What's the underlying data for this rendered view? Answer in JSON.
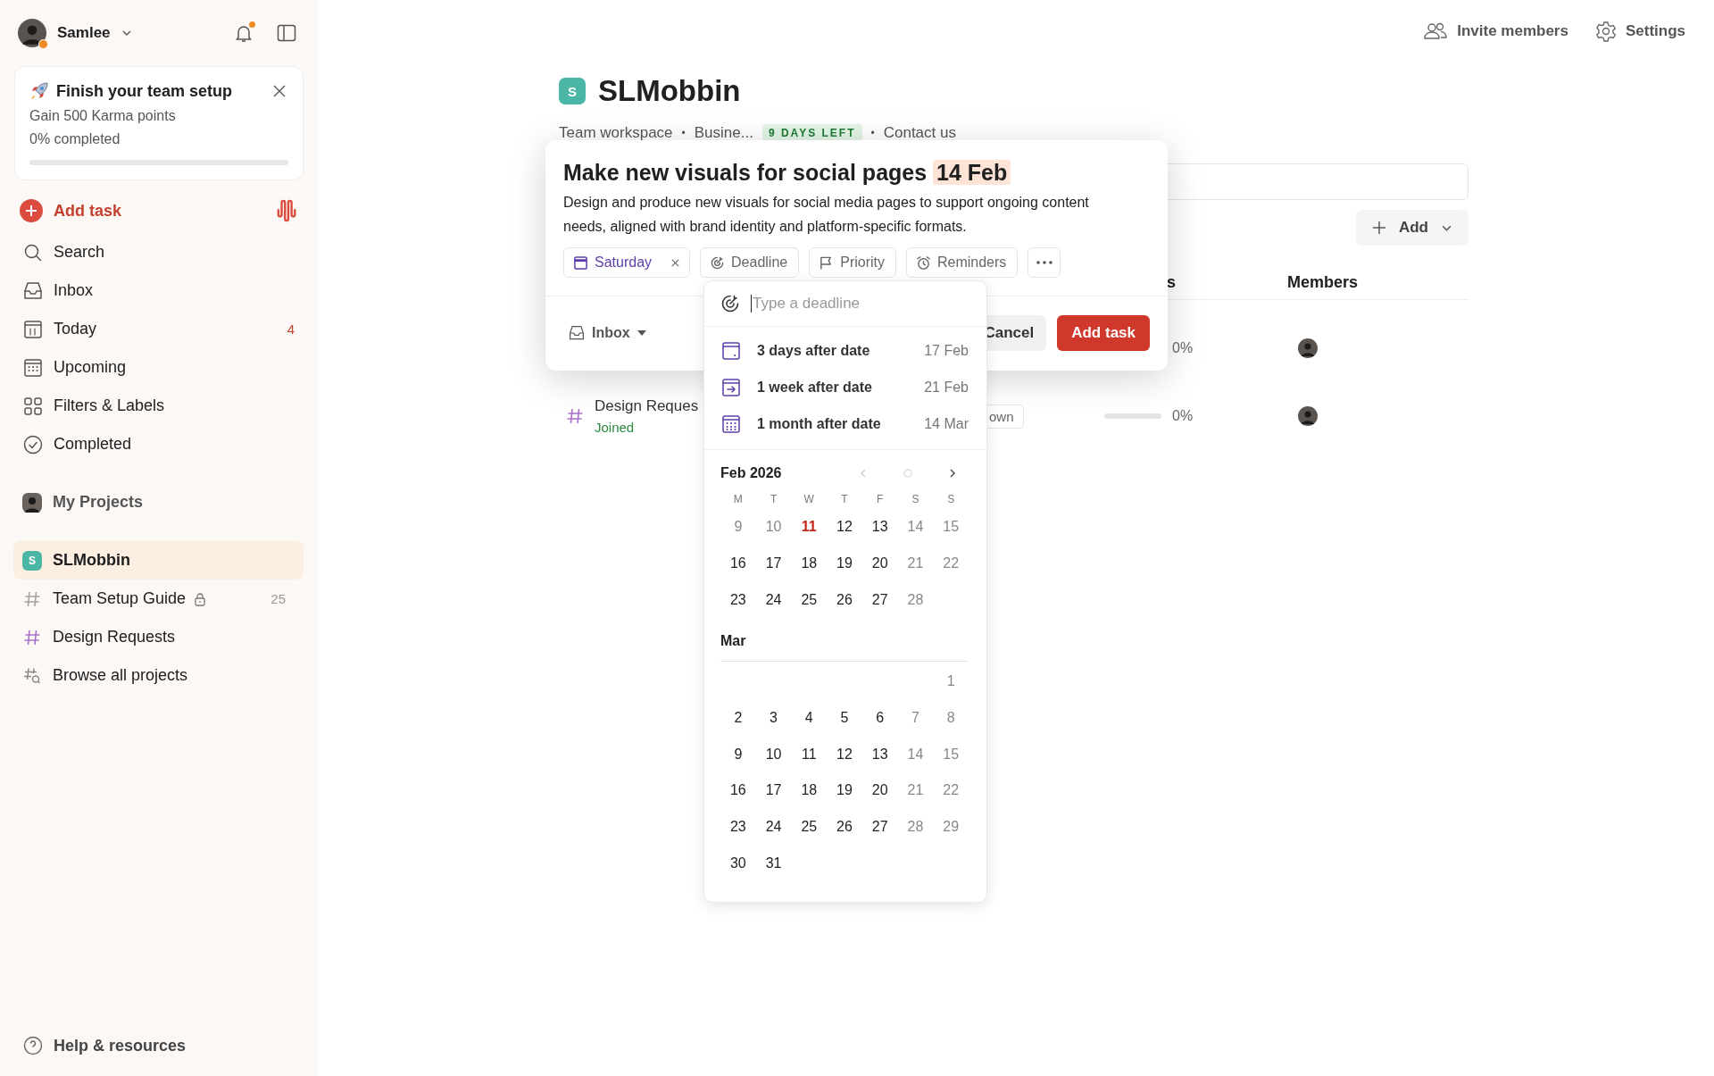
{
  "user": {
    "name": "Samlee",
    "online": true
  },
  "notifications": {
    "unread": true
  },
  "setup_card": {
    "title": "Finish your team setup",
    "subtitle": "Gain 500 Karma points",
    "progress_label": "0% completed",
    "level": 0
  },
  "add_task": "Add task",
  "nav": [
    {
      "label": "Search"
    },
    {
      "label": "Inbox"
    },
    {
      "label": "Today",
      "count": "4"
    },
    {
      "label": "Upcoming"
    },
    {
      "label": "Filters & Labels"
    },
    {
      "label": "Completed"
    }
  ],
  "my_projects": "My Projects",
  "projects": [
    {
      "label": "SLMobbin",
      "kind": "workspace",
      "badge": "S",
      "selected": true
    },
    {
      "label": "Team Setup Guide",
      "kind": "project",
      "color": "#a3a3a3",
      "locked": true,
      "count": "25",
      "selected": false
    },
    {
      "label": "Design Requests",
      "kind": "project",
      "color": "#a970c9",
      "locked": false,
      "selected": false
    },
    {
      "label": "Browse all projects",
      "kind": "browse",
      "selected": false
    }
  ],
  "help": "Help & resources",
  "header_actions": [
    "Invite members",
    "Settings"
  ],
  "project": {
    "badge": "S",
    "title": "SLMobbin",
    "breadcrumbs": [
      {
        "kind": "text",
        "text": "Team workspace"
      },
      {
        "kind": "separator",
        "text": "•"
      },
      {
        "kind": "text",
        "text": "Busine..."
      },
      {
        "kind": "badge",
        "text": "9 DAYS LEFT"
      },
      {
        "kind": "separator",
        "text": "•"
      },
      {
        "kind": "text",
        "text": "Contact us"
      }
    ]
  },
  "toolbar": {
    "add_label": "Add"
  },
  "table": {
    "columns": [
      "s",
      "Members"
    ],
    "rows": [
      {
        "progress_reading": "0%"
      },
      {
        "title": "Design Reques",
        "status": "Joined",
        "tag": "own",
        "level": 0,
        "progress_reading": "0%"
      }
    ]
  },
  "task_dialog": {
    "title": "Make new visuals for social pages",
    "date_token": "14 Feb",
    "description": "Design and produce new visuals for social media pages to support ongoing content needs, aligned with brand identity and platform-specific formats.",
    "chips": [
      {
        "kind": "date",
        "label": "Saturday"
      },
      {
        "kind": "option",
        "label": "Deadline"
      },
      {
        "kind": "option",
        "label": "Priority"
      },
      {
        "kind": "option",
        "label": "Reminders"
      },
      {
        "kind": "more"
      }
    ],
    "project_picker": "Inbox",
    "cancel": "Cancel",
    "submit": "Add task"
  },
  "deadline_menu": {
    "placeholder": "Type a deadline",
    "presets": [
      {
        "label": "3 days after date",
        "date": "17 Feb"
      },
      {
        "label": "1 week after date",
        "date": "21 Feb"
      },
      {
        "label": "1 month after date",
        "date": "14 Mar"
      }
    ],
    "weekdays": [
      "M",
      "T",
      "W",
      "T",
      "F",
      "S",
      "S"
    ],
    "months": [
      {
        "title": "Feb 2026",
        "days": [
          {
            "kind": "muted",
            "label": "9"
          },
          {
            "kind": "muted",
            "label": "10"
          },
          {
            "kind": "today",
            "label": "11"
          },
          {
            "kind": "normal",
            "label": "12"
          },
          {
            "kind": "normal",
            "label": "13"
          },
          {
            "kind": "muted",
            "label": "14"
          },
          {
            "kind": "muted",
            "label": "15"
          },
          {
            "kind": "normal",
            "label": "16"
          },
          {
            "kind": "normal",
            "label": "17"
          },
          {
            "kind": "normal",
            "label": "18"
          },
          {
            "kind": "normal",
            "label": "19"
          },
          {
            "kind": "normal",
            "label": "20"
          },
          {
            "kind": "muted",
            "label": "21"
          },
          {
            "kind": "muted",
            "label": "22"
          },
          {
            "kind": "normal",
            "label": "23"
          },
          {
            "kind": "normal",
            "label": "24"
          },
          {
            "kind": "normal",
            "label": "25"
          },
          {
            "kind": "normal",
            "label": "26"
          },
          {
            "kind": "normal",
            "label": "27"
          },
          {
            "kind": "muted",
            "label": "28"
          }
        ]
      },
      {
        "title": "Mar",
        "days": [
          {
            "kind": "blank"
          },
          {
            "kind": "blank"
          },
          {
            "kind": "blank"
          },
          {
            "kind": "blank"
          },
          {
            "kind": "blank"
          },
          {
            "kind": "blank"
          },
          {
            "kind": "muted",
            "label": "1"
          },
          {
            "kind": "normal",
            "label": "2"
          },
          {
            "kind": "normal",
            "label": "3"
          },
          {
            "kind": "normal",
            "label": "4"
          },
          {
            "kind": "normal",
            "label": "5"
          },
          {
            "kind": "normal",
            "label": "6"
          },
          {
            "kind": "muted",
            "label": "7"
          },
          {
            "kind": "muted",
            "label": "8"
          },
          {
            "kind": "normal",
            "label": "9"
          },
          {
            "kind": "normal",
            "label": "10"
          },
          {
            "kind": "normal",
            "label": "11"
          },
          {
            "kind": "normal",
            "label": "12"
          },
          {
            "kind": "normal",
            "label": "13"
          },
          {
            "kind": "muted",
            "label": "14"
          },
          {
            "kind": "muted",
            "label": "15"
          },
          {
            "kind": "normal",
            "label": "16"
          },
          {
            "kind": "normal",
            "label": "17"
          },
          {
            "kind": "normal",
            "label": "18"
          },
          {
            "kind": "normal",
            "label": "19"
          },
          {
            "kind": "normal",
            "label": "20"
          },
          {
            "kind": "muted",
            "label": "21"
          },
          {
            "kind": "muted",
            "label": "22"
          },
          {
            "kind": "normal",
            "label": "23"
          },
          {
            "kind": "normal",
            "label": "24"
          },
          {
            "kind": "normal",
            "label": "25"
          },
          {
            "kind": "normal",
            "label": "26"
          },
          {
            "kind": "normal",
            "label": "27"
          },
          {
            "kind": "muted",
            "label": "28"
          },
          {
            "kind": "muted",
            "label": "29"
          },
          {
            "kind": "normal",
            "label": "30"
          },
          {
            "kind": "normal",
            "label": "31"
          }
        ]
      }
    ]
  }
}
